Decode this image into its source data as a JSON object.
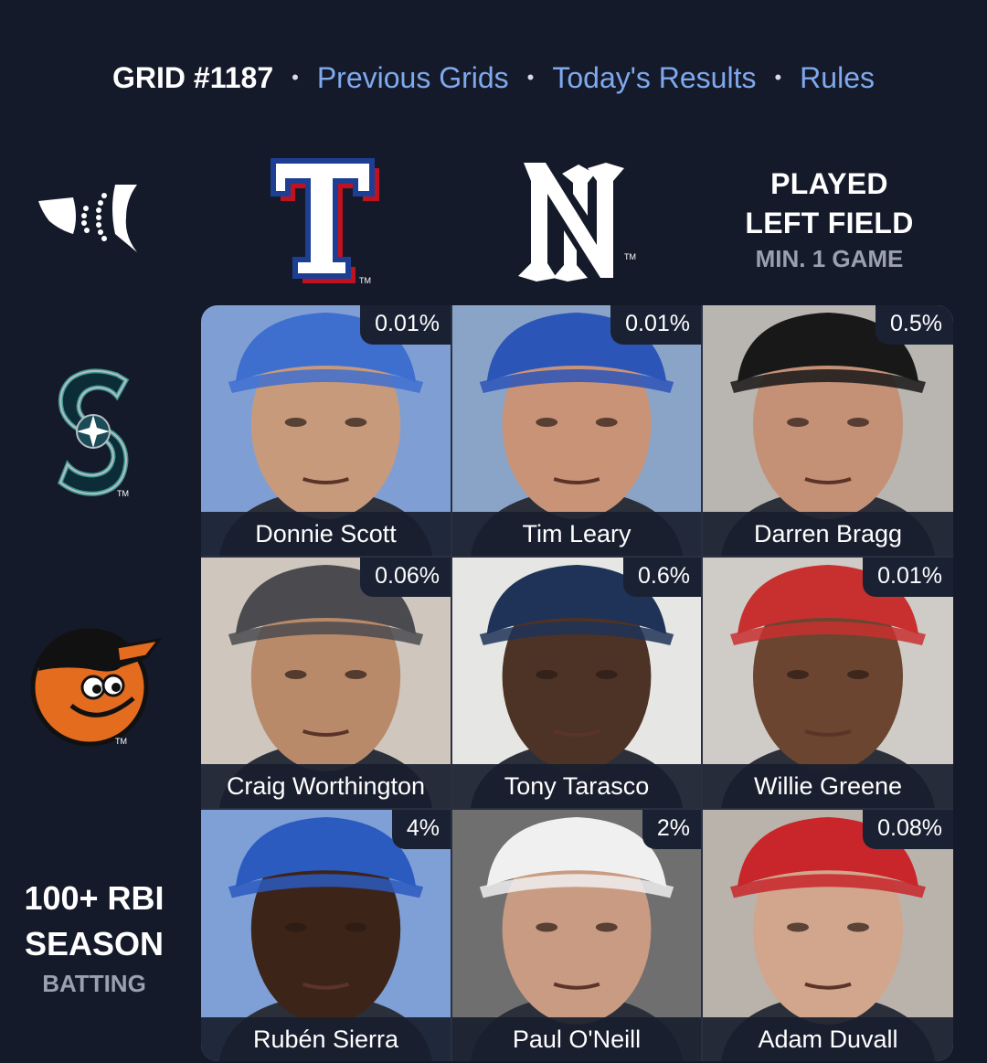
{
  "nav": {
    "title": "GRID #1187",
    "separator": "•",
    "previous_grids": "Previous Grids",
    "todays_results": "Today's Results",
    "rules": "Rules",
    "link_color": "#7fa9ec"
  },
  "columns": [
    {
      "type": "team-logo",
      "team": "Texas Rangers",
      "icon": "rangers-logo-icon",
      "logo_text": "T"
    },
    {
      "type": "team-logo",
      "team": "New York Yankees",
      "icon": "yankees-logo-icon",
      "logo_text": "NY"
    },
    {
      "type": "criteria",
      "line1": "PLAYED",
      "line2": "LEFT FIELD",
      "sub": "MIN. 1 GAME"
    }
  ],
  "rows": [
    {
      "type": "team-logo",
      "team": "Seattle Mariners",
      "icon": "mariners-logo-icon",
      "logo_text": "S"
    },
    {
      "type": "team-logo",
      "team": "Baltimore Orioles",
      "icon": "orioles-logo-icon"
    },
    {
      "type": "criteria",
      "line1": "100+ RBI",
      "line2": "SEASON",
      "sub": "BATTING"
    }
  ],
  "corner_icon": "immaculate-grid-logo-icon",
  "cells": [
    [
      {
        "name": "Donnie Scott",
        "pct": "0.01%",
        "cap_color": "#3e6fcf",
        "bg": "#7f9fd4",
        "skin": "#c79a7c"
      },
      {
        "name": "Tim Leary",
        "pct": "0.01%",
        "cap_color": "#2c55b8",
        "bg": "#8aa4c8",
        "skin": "#c99377"
      },
      {
        "name": "Darren Bragg",
        "pct": "0.5%",
        "cap_color": "#181818",
        "bg": "#b9b5b0",
        "skin": "#c49076"
      }
    ],
    [
      {
        "name": "Craig Worthington",
        "pct": "0.06%",
        "cap_color": "#4a4a4f",
        "bg": "#cfc6bd",
        "skin": "#b88a6a"
      },
      {
        "name": "Tony Tarasco",
        "pct": "0.6%",
        "cap_color": "#1f3358",
        "bg": "#e6e6e4",
        "skin": "#4d3226"
      },
      {
        "name": "Willie Greene",
        "pct": "0.01%",
        "cap_color": "#c8302f",
        "bg": "#cfcbc6",
        "skin": "#6b4530"
      }
    ],
    [
      {
        "name": "Rubén Sierra",
        "pct": "4%",
        "cap_color": "#2c5bc0",
        "bg": "#7ea0d6",
        "skin": "#3d2418"
      },
      {
        "name": "Paul O'Neill",
        "pct": "2%",
        "cap_color": "#f0f0f0",
        "bg": "#6f6f6f",
        "skin": "#c99b82"
      },
      {
        "name": "Adam Duvall",
        "pct": "0.08%",
        "cap_color": "#c8262a",
        "bg": "#b9b3ac",
        "skin": "#d1a68d"
      }
    ]
  ]
}
